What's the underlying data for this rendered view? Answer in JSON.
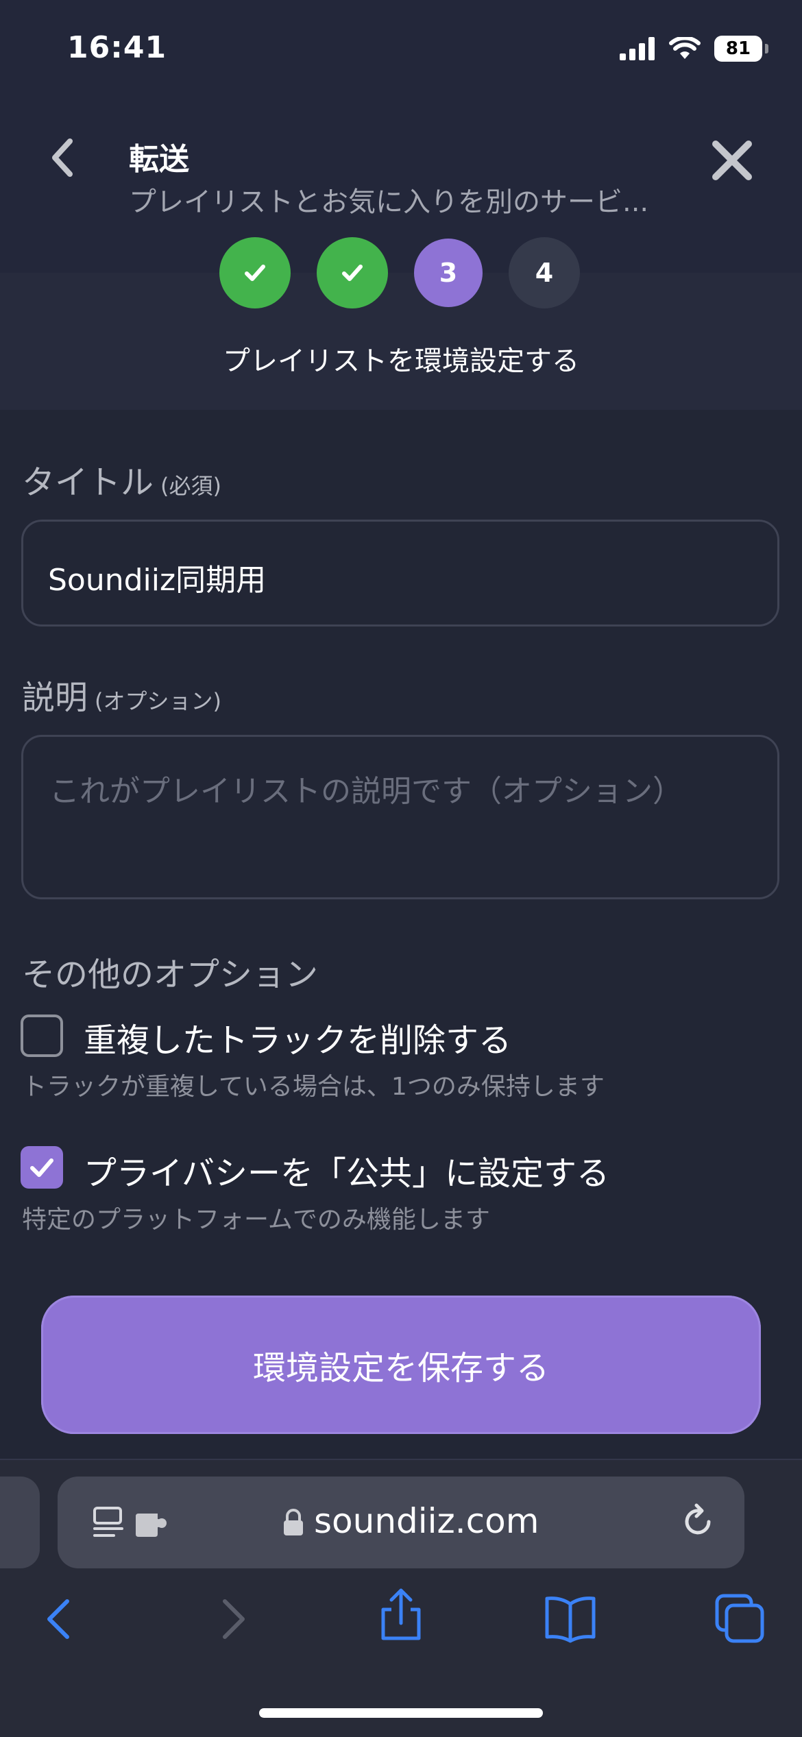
{
  "status_bar": {
    "time": "16:41",
    "battery": "81"
  },
  "header": {
    "title": "転送",
    "subtitle": "プレイリストとお気に入りを別のサービ...",
    "steps": [
      "✓",
      "✓",
      "3",
      "4"
    ],
    "step_label": "プレイリストを環境設定する"
  },
  "form": {
    "title_label": "タイトル",
    "title_required": "(必須)",
    "title_value": "Soundiiz同期用",
    "desc_label": "説明",
    "desc_optional": "(オプション)",
    "desc_placeholder": "これがプレイリストの説明です（オプション）",
    "options_title": "その他のオプション",
    "option1_label": "重複したトラックを削除する",
    "option1_desc": "トラックが重複している場合は、1つのみ保持します",
    "option1_checked": false,
    "option2_label": "プライバシーを「公共」に設定する",
    "option2_desc": "特定のプラットフォームでのみ機能します",
    "option2_checked": true
  },
  "save_button": "環境設定を保存する",
  "browser": {
    "url": "soundiiz.com"
  },
  "colors": {
    "accent": "#8e73d5",
    "done": "#43b34c",
    "link": "#3b82f6"
  }
}
